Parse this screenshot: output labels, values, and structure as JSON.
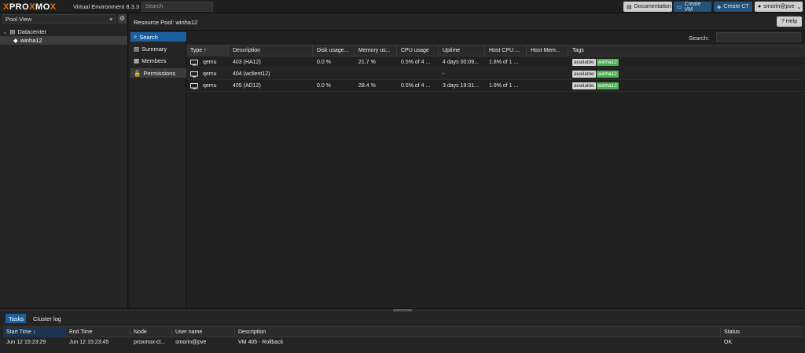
{
  "header": {
    "brand_pre": "PRO",
    "brand_x1": "X",
    "brand_mid": "MO",
    "brand_x2": "X",
    "version": "Virtual Environment 8.3.3",
    "search_placeholder": "Search",
    "documentation_label": "Documentation",
    "create_vm_label": "Create VM",
    "create_ct_label": "Create CT",
    "user_label": "smorin@pve"
  },
  "tree": {
    "view_label": "Pool View",
    "datacenter_label": "Datacenter",
    "pool_label": "winha12"
  },
  "main": {
    "title": "Resource Pool: winha12",
    "help_label": "Help",
    "search_label": "Search:"
  },
  "side_menu": [
    {
      "label": "Search",
      "icon": "search-icon",
      "state": "active"
    },
    {
      "label": "Summary",
      "icon": "book-icon",
      "state": ""
    },
    {
      "label": "Members",
      "icon": "grid-icon",
      "state": ""
    },
    {
      "label": "Permissions",
      "icon": "unlock-icon",
      "state": "selected"
    }
  ],
  "grid": {
    "columns": [
      "Type ↑",
      "Description",
      "Disk usage...",
      "Memory us...",
      "CPU usage",
      "Uptime",
      "Host CPU ...",
      "Host Mem...",
      "Tags"
    ],
    "rows": [
      {
        "type": "qemu",
        "description": "403 (HA12)",
        "disk": "0.0 %",
        "memory": "21.7 %",
        "cpu": "0.5% of 4 ...",
        "uptime": "4 days 00:09...",
        "host_cpu": "1.8% of 1 ...",
        "host_mem": "",
        "tags": [
          "available",
          "winha12"
        ],
        "running": true
      },
      {
        "type": "qemu",
        "description": "404 (wclient12)",
        "disk": "",
        "memory": "",
        "cpu": "",
        "uptime": "-",
        "host_cpu": "",
        "host_mem": "",
        "tags": [
          "available",
          "winha12"
        ],
        "running": false
      },
      {
        "type": "qemu",
        "description": "405 (AD12)",
        "disk": "0.0 %",
        "memory": "28.4 %",
        "cpu": "0.5% of 4 ...",
        "uptime": "3 days 19:31...",
        "host_cpu": "1.9% of 1 ...",
        "host_mem": "",
        "tags": [
          "available",
          "winha12"
        ],
        "running": true
      }
    ]
  },
  "bottom": {
    "tabs": [
      "Tasks",
      "Cluster log"
    ],
    "columns": [
      "Start Time ↓",
      "End Time",
      "Node",
      "User name",
      "Description",
      "Status"
    ],
    "rows": [
      {
        "start": "Jun 12 15:23:29",
        "end": "Jun 12 15:23:45",
        "node": "proxmox-cl...",
        "user": "smorin@pve",
        "description": "VM 405 - Rollback",
        "status": "OK"
      }
    ]
  },
  "colors": {
    "accent": "#1a5fa0",
    "brand_orange": "#e57000",
    "tag_green": "#4caf50",
    "running_green": "#4caf50"
  }
}
